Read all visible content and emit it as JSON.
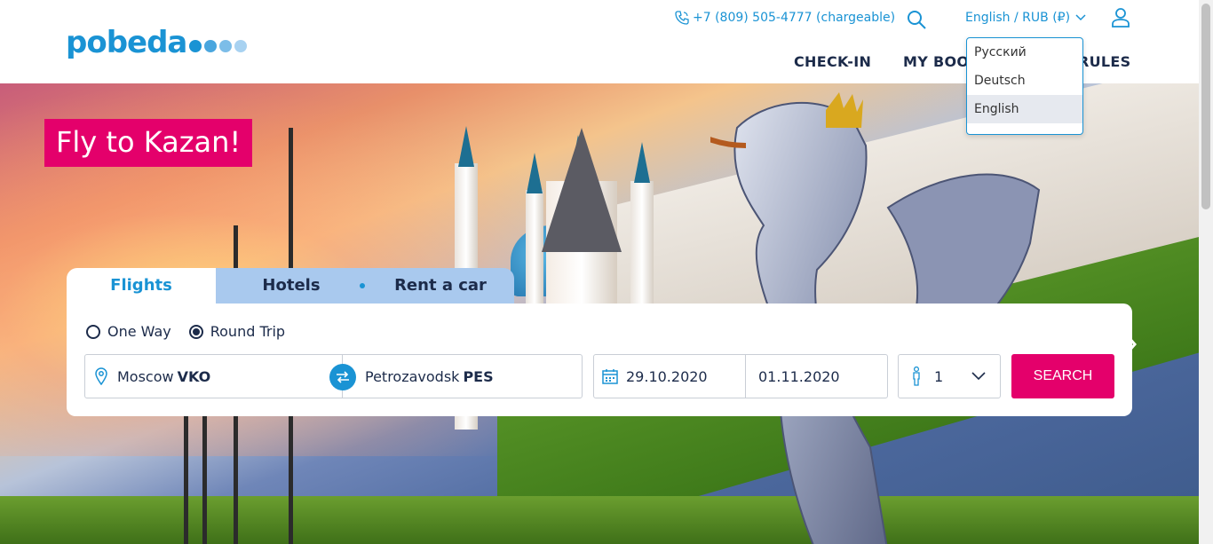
{
  "brand": {
    "logo_text": "pobeda",
    "dot_colors": [
      "#1a93d4",
      "#4aa6de",
      "#7cbde8",
      "#a8d2f1"
    ]
  },
  "header": {
    "phone": "+7 (809) 505-4777 (chargeable)",
    "language_selector": "English / RUB (₽)",
    "nav": {
      "checkin": "CHECK-IN",
      "my_booking": "MY BOOKING",
      "rules": "RULES"
    }
  },
  "language_menu": {
    "options": [
      "Русский",
      "Deutsch",
      "English"
    ],
    "selected": "English"
  },
  "hero": {
    "promo": "Fly to Kazan!"
  },
  "search": {
    "tabs": {
      "flights": "Flights",
      "hotels": "Hotels",
      "car": "Rent a car"
    },
    "trip_type": {
      "one_way": "One Way",
      "round_trip": "Round Trip",
      "selected": "Round Trip"
    },
    "from": {
      "city": "Moscow",
      "code": "VKO"
    },
    "to": {
      "city": "Petrozavodsk",
      "code": "PES"
    },
    "depart_date": "29.10.2020",
    "return_date": "01.11.2020",
    "passengers": "1",
    "button": "SEARCH"
  },
  "colors": {
    "brand_blue": "#1a93d4",
    "accent_pink": "#e4006b",
    "text_dark": "#1c2b4a",
    "tab_inactive": "#a9c9ee"
  }
}
